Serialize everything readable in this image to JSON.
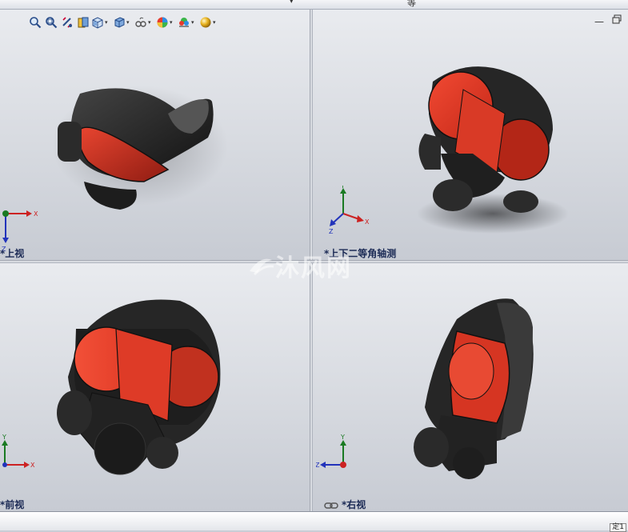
{
  "top_bar": {
    "tab_text": "等"
  },
  "statusbar": {
    "right_text": "定1"
  },
  "viewports": {
    "top": {
      "label": "*上视"
    },
    "iso": {
      "label": "*上下二等角轴测"
    },
    "front": {
      "label": "*前视"
    },
    "right": {
      "label": "*右视"
    }
  },
  "triad": {
    "x": "X",
    "y": "Y",
    "z": "Z"
  },
  "watermark": "沐风网",
  "toolbar": [
    "zoom-to-fit-icon",
    "zoom-to-area-icon",
    "previous-view-icon",
    "section-view-icon",
    "view-orientation-icon",
    "display-style-icon",
    "hide-show-items-icon",
    "edit-appearance-icon",
    "apply-scene-icon",
    "view-settings-icon"
  ],
  "colors": {
    "mask_lens": "#e8402c",
    "mask_body": "#262626",
    "background": "#e4e6ea"
  }
}
